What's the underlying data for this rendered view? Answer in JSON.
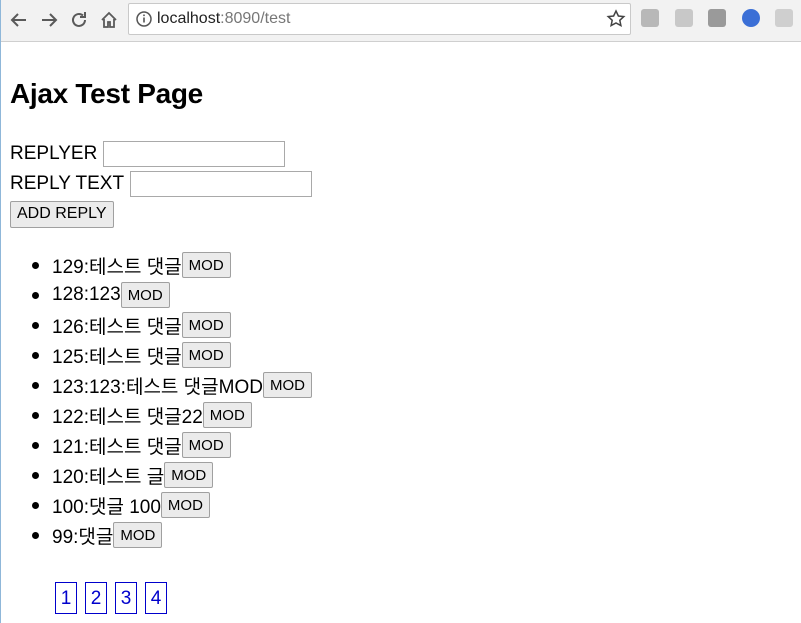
{
  "browser": {
    "url_host": "localhost",
    "url_rest": ":8090/test"
  },
  "page": {
    "title": "Ajax Test Page",
    "replyer_label": "REPLYER",
    "replyer_value": "",
    "reply_text_label": "REPLY TEXT",
    "reply_text_value": "",
    "add_button": "ADD REPLY",
    "mod_label": "MOD"
  },
  "replies": [
    {
      "text": "129:테스트 댓글"
    },
    {
      "text": "128:123"
    },
    {
      "text": "126:테스트 댓글"
    },
    {
      "text": "125:테스트 댓글"
    },
    {
      "text": "123:123:테스트 댓글MOD"
    },
    {
      "text": "122:테스트 댓글22"
    },
    {
      "text": "121:테스트 댓글"
    },
    {
      "text": "120:테스트 글"
    },
    {
      "text": "100:댓글 100"
    },
    {
      "text": "99:댓글"
    }
  ],
  "pagination": [
    "1",
    "2",
    "3",
    "4"
  ]
}
